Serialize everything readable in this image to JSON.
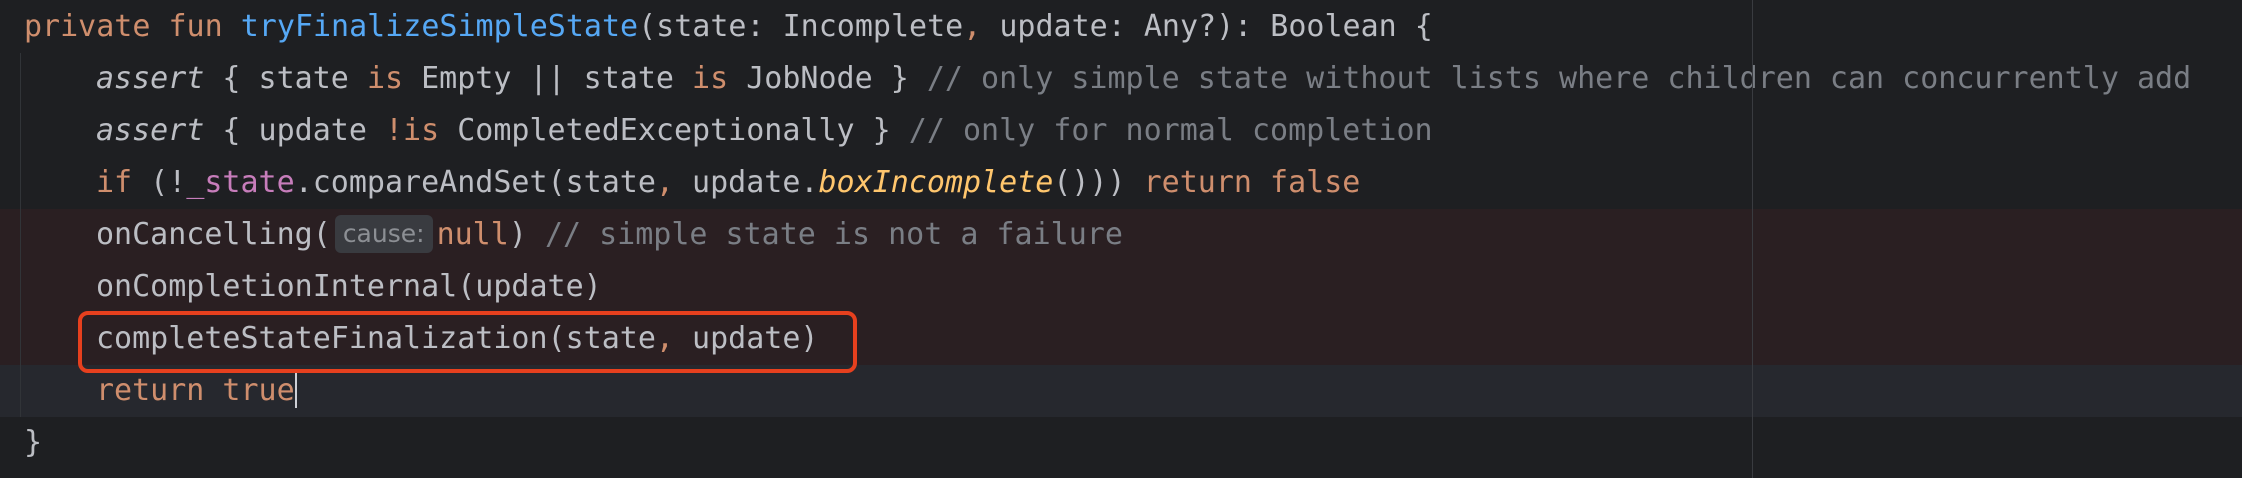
{
  "editor": {
    "line1": {
      "kw_private": "private",
      "kw_fun": "fun",
      "fn_name": "tryFinalizeSimpleState",
      "rest_a": "(state: Incomplete",
      "comma": ",",
      "rest_b": " update: Any?): Boolean {"
    },
    "line2": {
      "assert": "assert",
      "body_a": " { state ",
      "kw_is1": "is",
      "body_b": " Empty || state ",
      "kw_is2": "is",
      "body_c": " JobNode } ",
      "comment": "// only simple state without lists where children can concurrently add"
    },
    "line3": {
      "assert": "assert",
      "body_a": " { update ",
      "kw_notis": "!is",
      "body_b": " CompletedExceptionally } ",
      "comment": "// only for normal completion"
    },
    "line4": {
      "kw_if": "if",
      "body_a": " (!",
      "prop": "_state",
      "body_b": ".compareAndSet(state",
      "comma": ",",
      "body_c": " update.",
      "ext": "boxIncomplete",
      "body_d": "())) ",
      "kw_return": "return",
      "kw_false": " false"
    },
    "line5": {
      "call": "onCancelling(",
      "hint": "cause:",
      "kw_null": "null",
      "close": ") ",
      "comment": "// simple state is not a failure"
    },
    "line6": {
      "call": "onCompletionInternal(update)"
    },
    "line7": {
      "call_a": "completeStateFinalization(state",
      "comma": ",",
      "call_b": " update)"
    },
    "line8": {
      "kw_return": "return",
      "kw_true": " true"
    },
    "line9": {
      "brace": "}"
    }
  },
  "colors": {
    "background": "#1e1f22",
    "keyword": "#cf8e6d",
    "function_declaration": "#56a8f5",
    "comment": "#7a7e85",
    "property": "#c77dbb",
    "error_line_background": "#2a1f22",
    "highlight_box": "#e6401e"
  }
}
